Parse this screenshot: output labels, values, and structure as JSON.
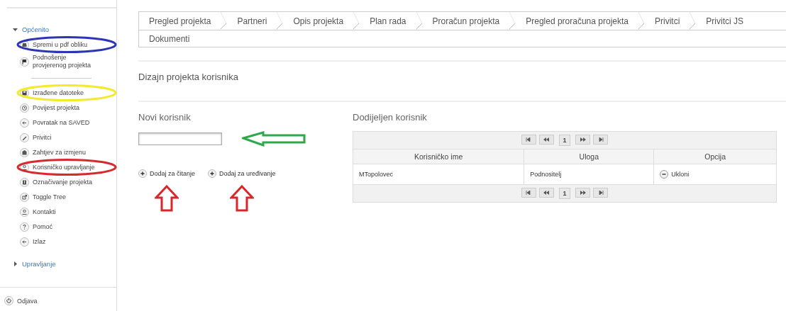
{
  "sidebar": {
    "sections": [
      {
        "label": "Općenito",
        "expanded": true,
        "groups": [
          {
            "items": [
              {
                "label": "Spremi u pdf obliku",
                "color": "#2b35b5"
              },
              {
                "label": "Podnošenje provjerenog projekta"
              }
            ]
          },
          {
            "items": [
              {
                "label": "Izrađene datoteke",
                "color": "#f2ea2a"
              },
              {
                "label": "Povijest projekta"
              },
              {
                "label": "Povratak na SAVED"
              },
              {
                "label": "Privitci"
              },
              {
                "label": "Zahtjev za izmjenu"
              },
              {
                "label": "Korisničko upravljanje",
                "color": "#d62a2e"
              },
              {
                "label": "Označivanje projekta"
              },
              {
                "label": "Toggle Tree"
              },
              {
                "label": "Kontakti"
              },
              {
                "label": "Pomoć"
              },
              {
                "label": "Izlaz"
              }
            ]
          }
        ]
      },
      {
        "label": "Upravljanje",
        "expanded": false
      }
    ],
    "logout": "Odjava"
  },
  "tab_rows": [
    [
      {
        "label": "Pregled projekta",
        "selected": false
      },
      {
        "label": "Partneri",
        "selected": false
      },
      {
        "label": "Opis projekta",
        "selected": false
      },
      {
        "label": "Plan rada",
        "selected": false
      },
      {
        "label": "Proračun projekta",
        "selected": false
      },
      {
        "label": "Pregled proračuna projekta",
        "selected": false
      },
      {
        "label": "Privitci",
        "selected": false
      },
      {
        "label": "Privitci JS",
        "selected": false
      }
    ],
    [
      {
        "label": "Dokumenti",
        "selected": false
      }
    ]
  ],
  "heading": "Dizajn projekta korisnika",
  "new_user": {
    "title": "Novi korisnik",
    "field": {
      "color": "#2fa84a"
    },
    "buttons": [
      {
        "label": "Dodaj za čitanje",
        "color": "#d9262b"
      },
      {
        "label": "Dodaj za uređivanje",
        "color": "#d9262b"
      }
    ]
  },
  "assigned": {
    "title": "Dodijeljen korisnik",
    "pager_top": {
      "page": "1"
    },
    "columns": [
      "Korisničko ime",
      "Uloga",
      "Opcija"
    ],
    "rows": [
      {
        "cells": [
          "MTopolovec",
          "Podnositelj"
        ],
        "action": "Ukloni"
      }
    ],
    "pager_bottom": {
      "page": "1"
    }
  }
}
